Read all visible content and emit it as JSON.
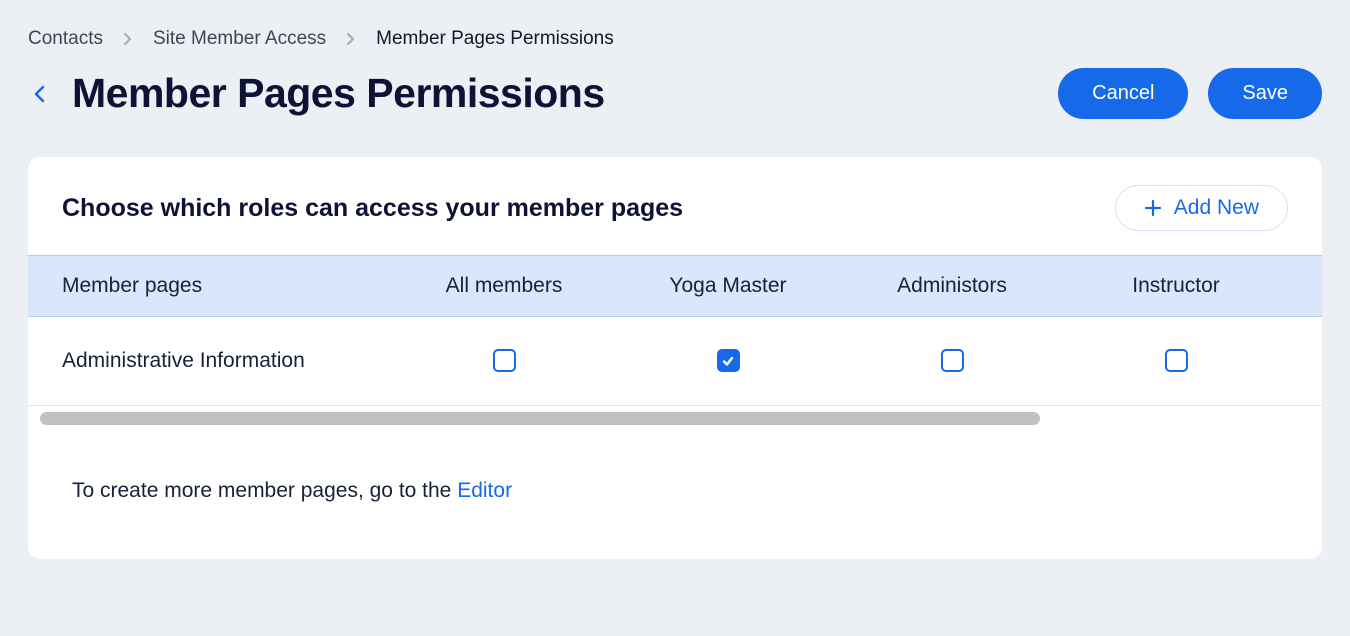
{
  "breadcrumb": {
    "items": [
      "Contacts",
      "Site Member Access",
      "Member Pages Permissions"
    ]
  },
  "header": {
    "title": "Member Pages Permissions",
    "cancel_label": "Cancel",
    "save_label": "Save"
  },
  "card": {
    "title": "Choose which roles can access your member pages",
    "add_new_label": "Add New"
  },
  "table": {
    "headers": {
      "name": "Member pages",
      "roles": [
        "All members",
        "Yoga Master",
        "Administors",
        "Instructor"
      ]
    },
    "rows": [
      {
        "name": "Administrative Information",
        "cells": [
          false,
          true,
          false,
          false
        ]
      }
    ]
  },
  "footer": {
    "text_prefix": "To create more member pages, go to the ",
    "link_label": "Editor"
  }
}
